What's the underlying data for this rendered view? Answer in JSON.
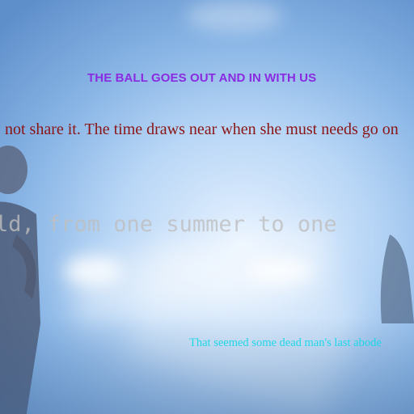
{
  "overlays": {
    "title": "THE BALL GOES OUT AND IN WITH US",
    "serif_line": "not share it. The time draws near when she must needs go on",
    "mono_line": "ld, from one summer to one",
    "caption": "That seemed some dead man's last abode"
  },
  "colors": {
    "title": "#8a2be2",
    "serif_line": "#8b1515",
    "mono_line": "#bebebe",
    "caption": "#1fd7e8"
  }
}
